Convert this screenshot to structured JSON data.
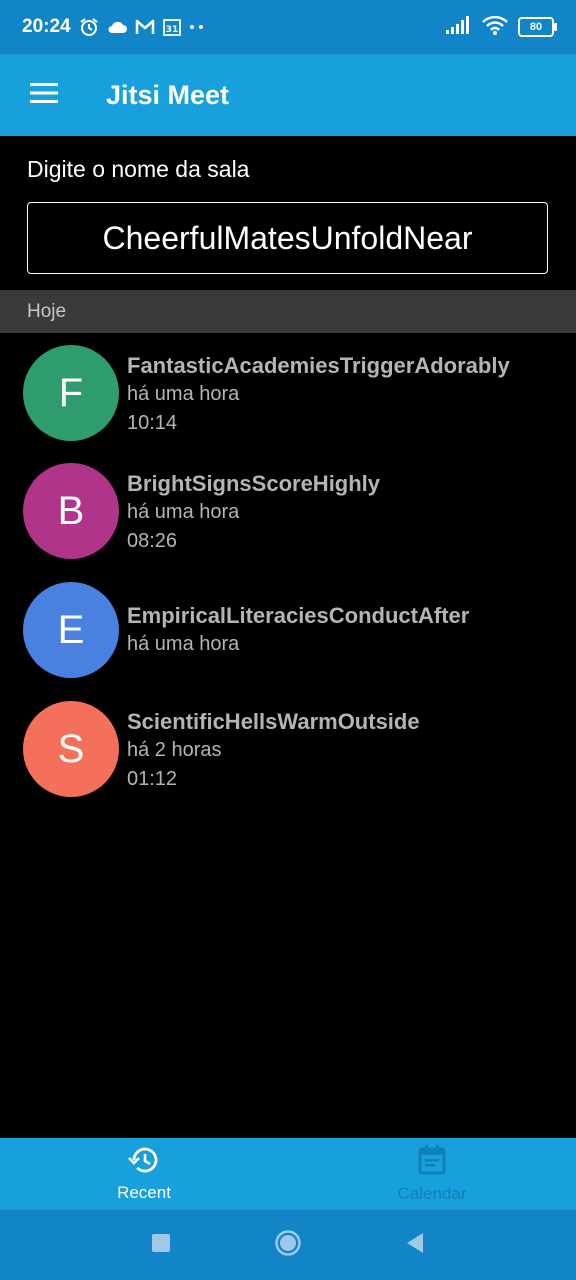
{
  "status_bar": {
    "time": "20:24",
    "battery": "80"
  },
  "app_bar": {
    "title": "Jitsi Meet"
  },
  "room": {
    "label": "Digite o nome da sala",
    "value": "CheerfulMatesUnfoldNear"
  },
  "section": {
    "title": "Hoje"
  },
  "meetings": [
    {
      "initial": "F",
      "title": "FantasticAcademiesTriggerAdorably",
      "when": "há uma hora",
      "time": "10:14",
      "color": "#2e9c6c"
    },
    {
      "initial": "B",
      "title": "BrightSignsScoreHighly",
      "when": "há uma hora",
      "time": "08:26",
      "color": "#b0348a"
    },
    {
      "initial": "E",
      "title": "EmpiricalLiteraciesConductAfter",
      "when": "há uma hora",
      "time": "",
      "color": "#4a80e0"
    },
    {
      "initial": "S",
      "title": "ScientificHellsWarmOutside",
      "when": "há 2 horas",
      "time": "01:12",
      "color": "#f4705a"
    }
  ],
  "tabs": [
    {
      "label": "Recent",
      "icon": "history-icon",
      "active": true
    },
    {
      "label": "Calendar",
      "icon": "calendar-icon",
      "active": false
    }
  ],
  "colors": {
    "app_bar": "#17a0db",
    "status_bar": "#1285c8"
  }
}
